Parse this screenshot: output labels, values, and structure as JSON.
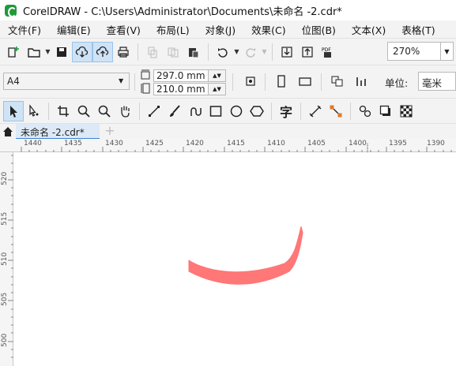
{
  "window": {
    "title": "CorelDRAW - C:\\Users\\Administrator\\Documents\\未命名 -2.cdr*"
  },
  "menu": [
    "文件(F)",
    "编辑(E)",
    "查看(V)",
    "布局(L)",
    "对象(J)",
    "效果(C)",
    "位图(B)",
    "文本(X)",
    "表格(T)"
  ],
  "toolbar": {
    "zoom_value": "270%",
    "pdf_label": "PDF"
  },
  "property_bar": {
    "page_size": "A4",
    "width": "297.0 mm",
    "height": "210.0 mm",
    "unit_label": "单位:",
    "unit_value": "毫米"
  },
  "tools": {
    "text_tool_glyph": "字"
  },
  "tabs": {
    "doc_tab": "未命名 -2.cdr*",
    "add_tab": "+"
  },
  "ruler_h": [
    "1440",
    "1435",
    "1430",
    "1425",
    "1420",
    "1415",
    "1410",
    "1405",
    "1400",
    "1395",
    "1390"
  ],
  "ruler_v": [
    "520",
    "515",
    "510",
    "505",
    "500"
  ],
  "colors": {
    "shape_fill": "#ff7777",
    "accent": "#3c84d4",
    "selected_tool": "#cfe3f6"
  }
}
